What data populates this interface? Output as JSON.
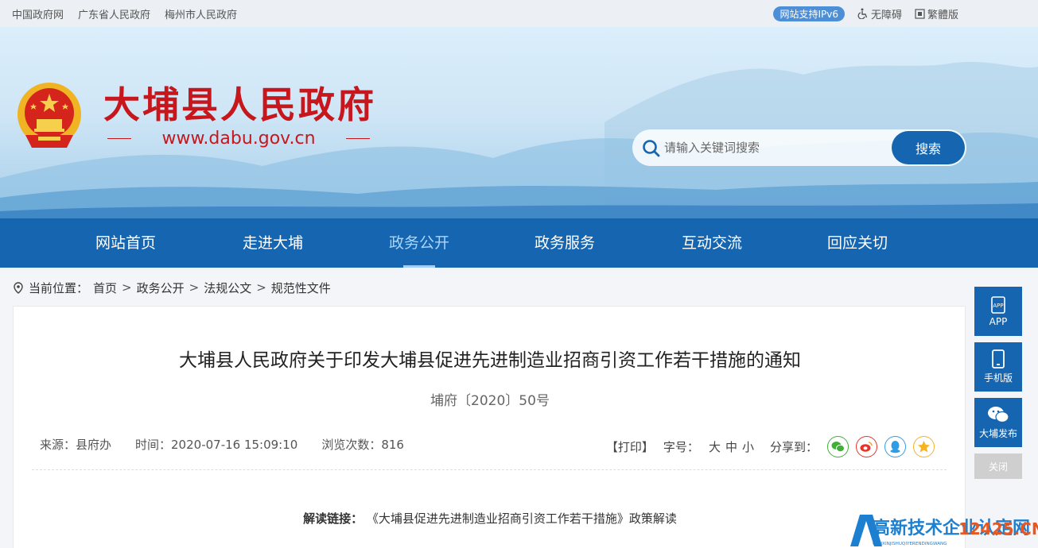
{
  "topbar": {
    "links": [
      "中国政府网",
      "广东省人民政府",
      "梅州市人民政府"
    ],
    "ipv6": "网站支持IPv6",
    "accessibility": "无障碍",
    "traditional": "繁體版"
  },
  "header": {
    "title": "大埔县人民政府",
    "url": "www.dabu.gov.cn",
    "search_placeholder": "请输入关键词搜索",
    "search_button": "搜索"
  },
  "nav": {
    "items": [
      "网站首页",
      "走进大埔",
      "政务公开",
      "政务服务",
      "互动交流",
      "回应关切"
    ],
    "active": "政务公开"
  },
  "breadcrumb": {
    "label": "当前位置：",
    "items": [
      "首页",
      "政务公开",
      "法规公文",
      "规范性文件"
    ],
    "sep": ">"
  },
  "article": {
    "title": "大埔县人民政府关于印发大埔县促进先进制造业招商引资工作若干措施的通知",
    "doc_no": "埔府〔2020〕50号",
    "source": "来源：县府办",
    "time": "时间：2020-07-16 15:09:10",
    "views": "浏览次数：816",
    "print": "【打印】",
    "font_label": "字号：",
    "font_large": "大",
    "font_medium": "中",
    "font_small": "小",
    "share_label": "分享到：",
    "reading_label": "解读链接：",
    "reading_text": "《大埔县促进先进制造业招商引资工作若干措施》政策解读"
  },
  "sidebar": {
    "app": "APP",
    "mobile": "手机版",
    "wechat": "大埔发布",
    "close": "关闭"
  },
  "watermark": {
    "text": "高新技术企业认定网",
    "domain": "12425.CN",
    "pinyin": "GAOXINJISHUQIYERENDINGWANG"
  },
  "colors": {
    "brand_blue": "#1565b0",
    "title_red": "#c8161d"
  }
}
